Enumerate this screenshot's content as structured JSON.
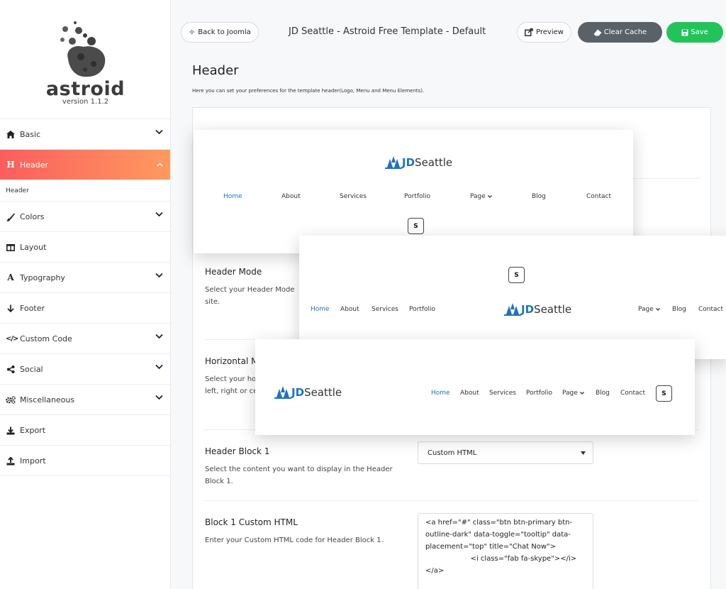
{
  "app": {
    "brand_name": "astroid",
    "version": "version 1.1.2"
  },
  "sidebar": {
    "items": [
      {
        "label": "Basic",
        "icon": "home-icon",
        "has_chevron": true
      },
      {
        "label": "Header",
        "icon": "heading-icon",
        "active": true
      },
      {
        "label": "Colors",
        "icon": "brush-icon",
        "has_chevron": true
      },
      {
        "label": "Layout",
        "icon": "columns-icon"
      },
      {
        "label": "Typography",
        "icon": "font-icon",
        "has_chevron": true
      },
      {
        "label": "Footer",
        "icon": "arrow-down-icon"
      },
      {
        "label": "Custom Code",
        "icon": "code-icon",
        "has_chevron": true
      },
      {
        "label": "Social",
        "icon": "share-icon",
        "has_chevron": true
      },
      {
        "label": "Miscellaneous",
        "icon": "cogs-icon",
        "has_chevron": true
      },
      {
        "label": "Export",
        "icon": "download-icon"
      },
      {
        "label": "Import",
        "icon": "upload-icon"
      }
    ],
    "subitem": "Header"
  },
  "topbar": {
    "back_label": "Back to Joomla",
    "title": "JD Seattle - Astroid Free Template - Default",
    "preview_label": "Preview",
    "clear_cache_label": "Clear Cache",
    "save_label": "Save"
  },
  "page": {
    "title": "Header",
    "description": "Here you can set your preferences for the template header(Logo, Menu and Menu Elements)."
  },
  "fields": {
    "header_mode": {
      "label": "Header Mode",
      "help": "Select your Header Mode",
      "help2": "site."
    },
    "horizontal": {
      "label": "Horizontal M",
      "help": "Select your ho",
      "help2": "left, right or ce"
    },
    "header_block_1": {
      "label": "Header Block 1",
      "help": "Select the content you want to display in the Header Block 1.",
      "value": "Custom HTML"
    },
    "block1_custom_html": {
      "label": "Block 1 Custom HTML",
      "help": "Enter your Custom HTML code for Header Block 1.",
      "value": "<a href=\"#\" class=\"btn btn-primary btn-outline-dark\" data-toggle=\"tooltip\" data-placement=\"top\" title=\"Chat Now\">\n                    <i class=\"fab fa-skype\"></i></a>"
    }
  },
  "preview": {
    "logo_prefix": "JD",
    "logo_suffix": "Seattle",
    "menu": [
      "Home",
      "About",
      "Services",
      "Portfolio",
      "Page",
      "Blog",
      "Contact"
    ],
    "skype_glyph": "S"
  },
  "colors": {
    "active_start": "#fb5d5d",
    "active_end": "#ff9a5e",
    "save": "#22c45a",
    "clear": "#5a6268",
    "link": "#1e73be"
  }
}
